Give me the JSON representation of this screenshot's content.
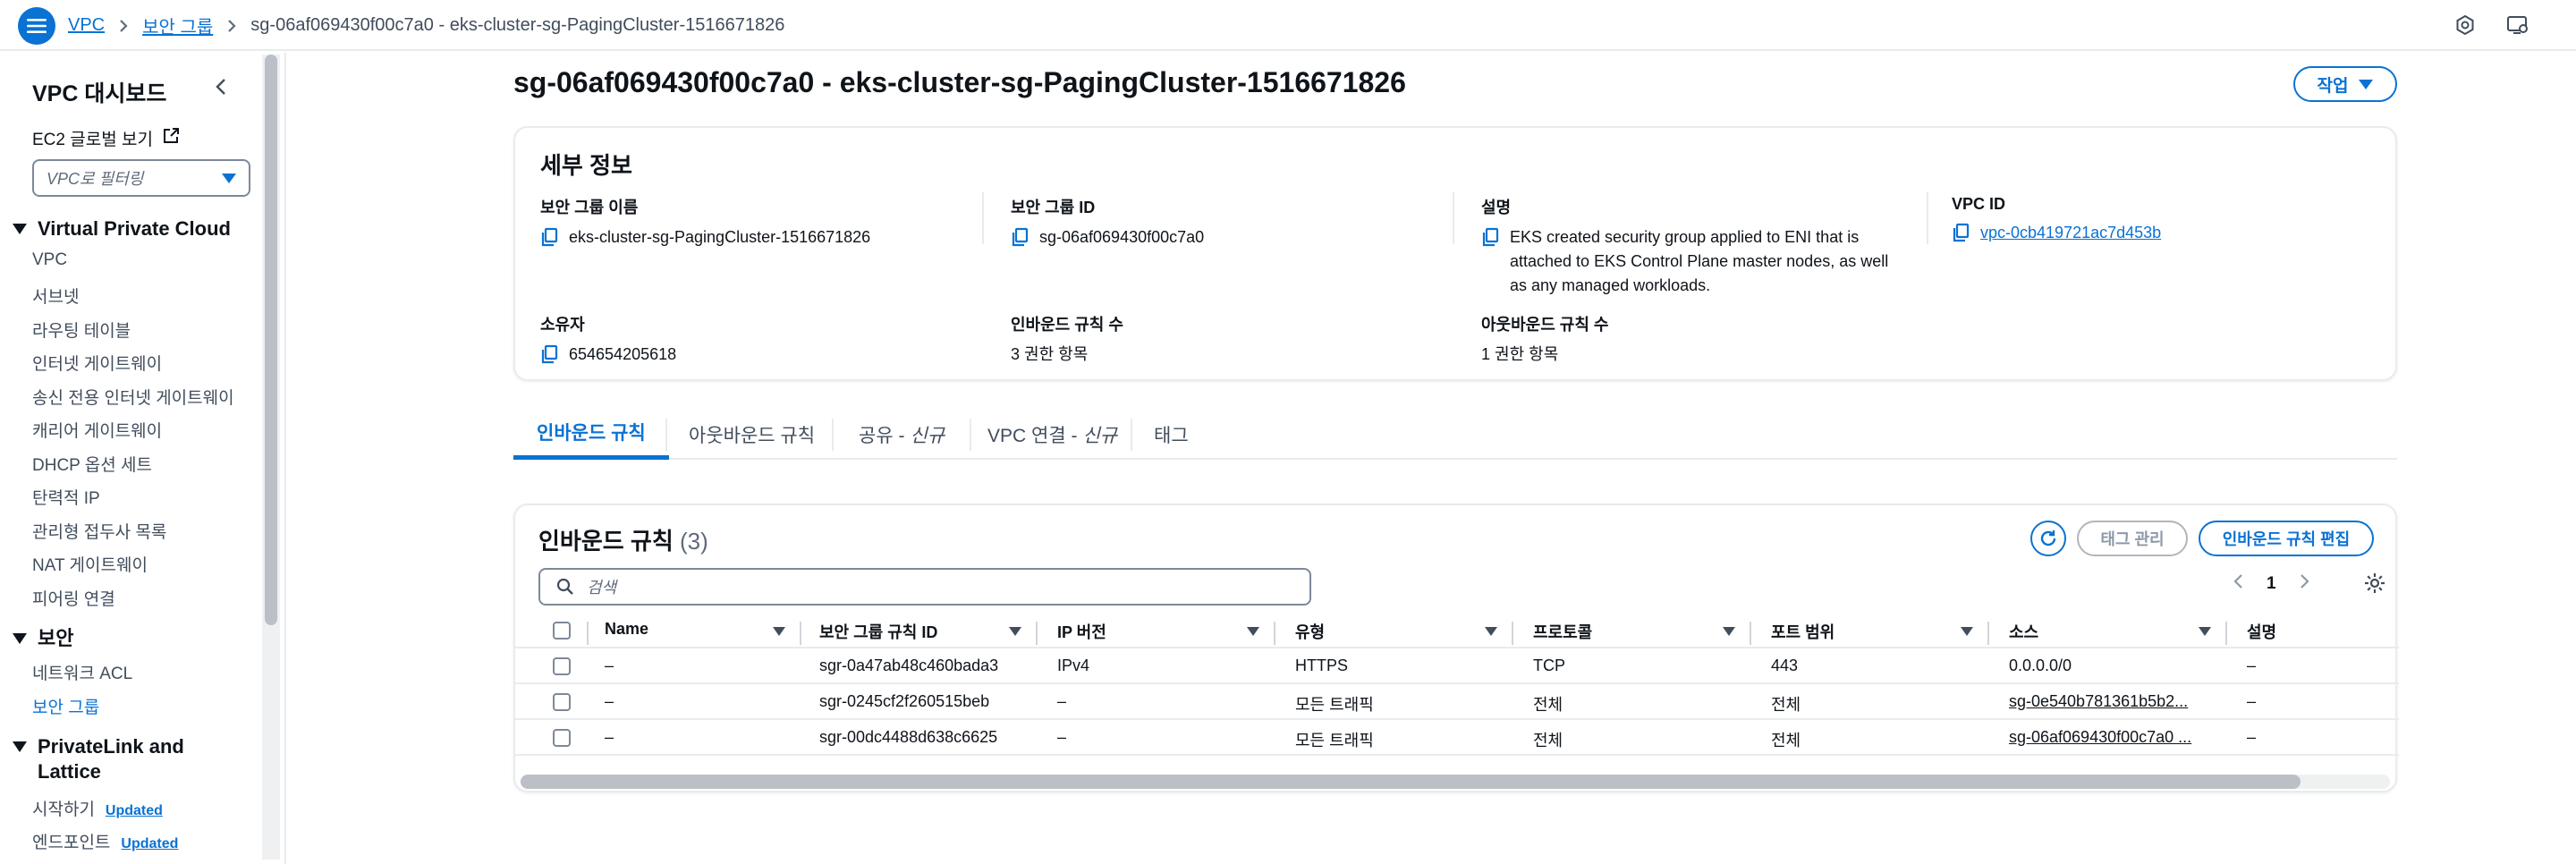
{
  "breadcrumb": {
    "items": [
      "VPC",
      "보안 그룹"
    ],
    "current": "sg-06af069430f00c7a0 - eks-cluster-sg-PagingCluster-1516671826"
  },
  "topbar_icons": [
    "notification-icon",
    "settings-icon"
  ],
  "sidebar": {
    "title": "VPC 대시보드",
    "ec2_global": "EC2 글로벌 보기",
    "filter_placeholder": "VPC로 필터링",
    "sections": [
      {
        "title": "Virtual Private Cloud",
        "items": [
          "VPC",
          "서브넷",
          "라우팅 테이블",
          "인터넷 게이트웨이",
          "송신 전용 인터넷 게이트웨이",
          "캐리어 게이트웨이",
          "DHCP 옵션 세트",
          "탄력적 IP",
          "관리형 접두사 목록",
          "NAT 게이트웨이",
          "피어링 연결"
        ]
      },
      {
        "title": "보안",
        "items": [
          "네트워크 ACL",
          "보안 그룹"
        ]
      },
      {
        "title": "PrivateLink and Lattice",
        "items": [
          "시작하기",
          "엔드포인트"
        ],
        "badge": "Updated"
      }
    ]
  },
  "page": {
    "title": "sg-06af069430f00c7a0 - eks-cluster-sg-PagingCluster-1516671826",
    "action_button": "작업"
  },
  "details": {
    "heading": "세부 정보",
    "fields": [
      {
        "label": "보안 그룹 이름",
        "value": "eks-cluster-sg-PagingCluster-1516671826"
      },
      {
        "label": "보안 그룹 ID",
        "value": "sg-06af069430f00c7a0"
      },
      {
        "label": "설명",
        "value": "EKS created security group applied to ENI that is attached to EKS Control Plane master nodes, as well as any managed workloads."
      },
      {
        "label": "VPC ID",
        "value": "vpc-0cb419721ac7d453b"
      },
      {
        "label": "소유자",
        "value": "654654205618"
      },
      {
        "label": "인바운드 규칙 수",
        "value": "3 권한 항목"
      },
      {
        "label": "아웃바운드 규칙 수",
        "value": "1 권한 항목"
      }
    ]
  },
  "tabs": [
    {
      "label": "인바운드 규칙",
      "suffix": ""
    },
    {
      "label": "아웃바운드 규칙",
      "suffix": ""
    },
    {
      "label": "공유 -",
      "suffix": "신규"
    },
    {
      "label": "VPC 연결 -",
      "suffix": "신규"
    },
    {
      "label": "태그",
      "suffix": ""
    }
  ],
  "inbound": {
    "title": "인바운드 규칙",
    "count": "(3)",
    "manage_tags": "태그 관리",
    "edit_button": "인바운드 규칙 편집",
    "search_placeholder": "검색",
    "page": "1",
    "columns": [
      "Name",
      "보안 그룹 규칙 ID",
      "IP 버전",
      "유형",
      "프로토콜",
      "포트 범위",
      "소스",
      "설명"
    ],
    "rows": [
      [
        "–",
        "sgr-0a47ab48c460bada3",
        "IPv4",
        "HTTPS",
        "TCP",
        "443",
        "0.0.0.0/0",
        "–"
      ],
      [
        "–",
        "sgr-0245cf2f260515beb",
        "–",
        "모든 트래픽",
        "전체",
        "전체",
        "sg-0e540b781361b5b2...",
        "–"
      ],
      [
        "–",
        "sgr-00dc4488d638c6625",
        "–",
        "모든 트래픽",
        "전체",
        "전체",
        "sg-06af069430f00c7a0 ...",
        "–"
      ]
    ]
  },
  "colors": {
    "accent": "#0972d3",
    "text": "#0f141a",
    "border": "#e9ebed"
  }
}
